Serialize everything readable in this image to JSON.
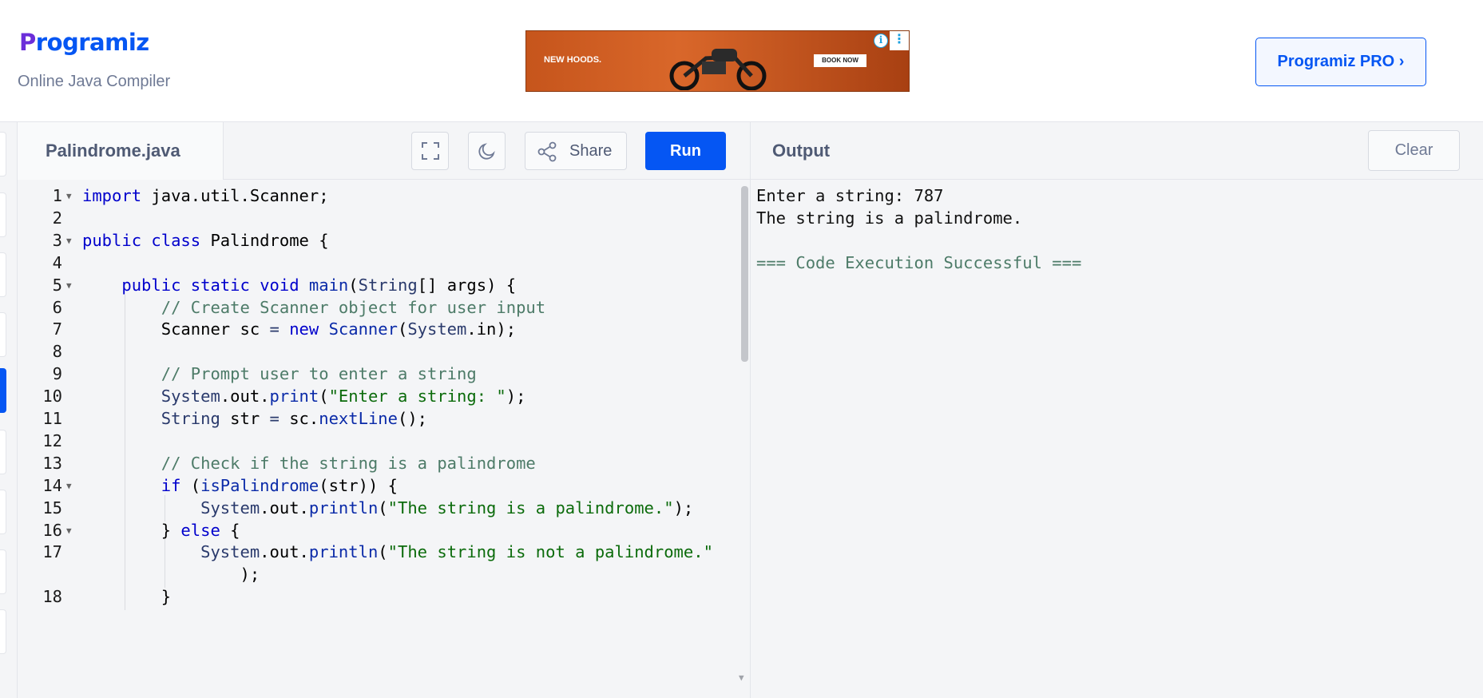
{
  "header": {
    "logo_text": "rogramiz",
    "logo_initial": "P",
    "subtitle": "Online Java Compiler",
    "pro_button": "Programiz PRO ›",
    "ad": {
      "headline": "NEW HOODS.",
      "cta": "BOOK NOW",
      "info": "i",
      "more": "⋮"
    }
  },
  "editor": {
    "filename": "Palindrome.java",
    "share_label": "Share",
    "run_label": "Run",
    "lines": [
      {
        "n": "1",
        "fold": true,
        "indent": 0,
        "text": "<span class='kw'>import</span> java.util.Scanner;"
      },
      {
        "n": "2",
        "fold": false,
        "indent": 0,
        "text": ""
      },
      {
        "n": "3",
        "fold": true,
        "indent": 0,
        "text": "<span class='kw'>public</span> <span class='kw'>class</span> Palindrome {"
      },
      {
        "n": "4",
        "fold": false,
        "indent": 0,
        "text": ""
      },
      {
        "n": "5",
        "fold": true,
        "indent": 1,
        "text": "    <span class='kw'>public</span> <span class='kw'>static</span> <span class='kw'>void</span> <span class='fn'>main</span>(<span class='cl'>String</span>[] args) {"
      },
      {
        "n": "6",
        "fold": false,
        "indent": 2,
        "text": "        <span class='cm'>// Create Scanner object for user input</span>"
      },
      {
        "n": "7",
        "fold": false,
        "indent": 2,
        "text": "        Scanner sc <span class='cl'>=</span> <span class='kw'>new</span> <span class='fn'>Scanner</span>(<span class='cl'>System</span>.in);"
      },
      {
        "n": "8",
        "fold": false,
        "indent": 2,
        "text": ""
      },
      {
        "n": "9",
        "fold": false,
        "indent": 2,
        "text": "        <span class='cm'>// Prompt user to enter a string</span>"
      },
      {
        "n": "10",
        "fold": false,
        "indent": 2,
        "text": "        <span class='cl'>System</span>.out.<span class='fn'>print</span>(<span class='st'>\"Enter a string: \"</span>);"
      },
      {
        "n": "11",
        "fold": false,
        "indent": 2,
        "text": "        <span class='cl'>String</span> str <span class='cl'>=</span> sc.<span class='fn'>nextLine</span>();"
      },
      {
        "n": "12",
        "fold": false,
        "indent": 2,
        "text": ""
      },
      {
        "n": "13",
        "fold": false,
        "indent": 2,
        "text": "        <span class='cm'>// Check if the string is a palindrome</span>"
      },
      {
        "n": "14",
        "fold": true,
        "indent": 2,
        "text": "        <span class='kw'>if</span> (<span class='fn'>isPalindrome</span>(str)) {"
      },
      {
        "n": "15",
        "fold": false,
        "indent": 3,
        "text": "            <span class='cl'>System</span>.out.<span class='fn'>println</span>(<span class='st'>\"The string is a palindrome.\"</span>);"
      },
      {
        "n": "16",
        "fold": true,
        "indent": 2,
        "text": "        } <span class='kw'>else</span> {"
      },
      {
        "n": "17",
        "fold": false,
        "indent": 3,
        "text": "            <span class='cl'>System</span>.out.<span class='fn'>println</span>(<span class='st'>\"The string is not a palindrome.\"</span>"
      },
      {
        "n": "",
        "fold": false,
        "indent": 3,
        "text": "                );"
      },
      {
        "n": "18",
        "fold": false,
        "indent": 2,
        "text": "        }"
      }
    ]
  },
  "output": {
    "title": "Output",
    "clear_label": "Clear",
    "lines": [
      {
        "text": "Enter a string: 787",
        "success": false
      },
      {
        "text": "The string is a palindrome.",
        "success": false
      },
      {
        "text": "",
        "success": false
      },
      {
        "text": "=== Code Execution Successful ===",
        "success": true
      }
    ]
  },
  "colors": {
    "accent": "#0556f3",
    "logo_initial": "#6b2ed9",
    "comment": "#4d7b68",
    "string": "#0b6b0b",
    "keyword": "#0000cc"
  },
  "icons": [
    "fullscreen-icon",
    "moon-icon",
    "share-icon",
    "ad-info-icon",
    "ad-more-icon",
    "fold-arrow-icon"
  ]
}
